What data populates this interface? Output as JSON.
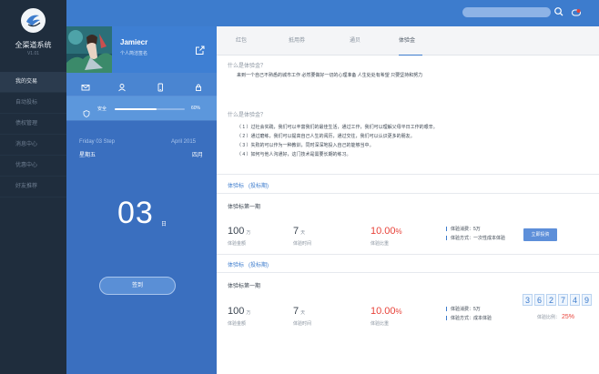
{
  "sidebar": {
    "brand": "全渠道系统",
    "version": "V1.01",
    "items": [
      {
        "label": "我的交易",
        "active": true
      },
      {
        "label": "自动投标",
        "active": false
      },
      {
        "label": "债权管理",
        "active": false
      },
      {
        "label": "消息中心",
        "active": false
      },
      {
        "label": "优惠中心",
        "active": false
      },
      {
        "label": "好友推荐",
        "active": false
      }
    ]
  },
  "profile": {
    "name": "Jamiecr",
    "subtitle": "个人简洁签名"
  },
  "security": {
    "label": "安全",
    "percent": "60%",
    "level": 0.6
  },
  "date": {
    "left": "Friday  03  Step",
    "right": "April  2015",
    "weekday": "星期五",
    "month": "四月",
    "day": "03",
    "day_unit": "日",
    "checkin": "签到"
  },
  "tabs": [
    {
      "label": "红包",
      "active": false
    },
    {
      "label": "抵用券",
      "active": false
    },
    {
      "label": "通贝",
      "active": false
    },
    {
      "label": "体验金",
      "active": true
    }
  ],
  "faq": {
    "q1": "什么是体验金？",
    "a1": "来到一个自己不熟悉的城市工作 必然要做好一切的心理准备  人生处处有希望 只要坚持和努力",
    "q2": "什么是体验金？",
    "points": [
      "（ 1 ）过社会实践，我们可以丰富我们的最佳生活，通过工作，我们可以理解父母平日工作的艰辛。",
      "（ 2 ）通过磨练，我们可以提高自己人生的阅历，通过交往，我们可以认识更多的朋友。",
      "（ 3 ）失败的可以作为一种教训，同时深深地投入自己的能够当中。",
      "（ 4 ）如何与他人沟通好，这门技术是需要长期的练习。"
    ]
  },
  "plans": [
    {
      "head": "体验标",
      "head_link": "(投标期)",
      "name": "体验标第一期",
      "amount": "100",
      "amount_unit": "万",
      "amount_cap": "体验金额",
      "days": "7",
      "days_unit": "天",
      "days_cap": "体验时间",
      "rate": "10.00",
      "rate_unit": "%",
      "rate_cap": "体验比重",
      "info1": "体验消费：5万",
      "info2": "体验方式：一次性成本体验",
      "button": "立即投资"
    },
    {
      "head": "体验标",
      "head_link": "(投标期)",
      "name": "体验标第一期",
      "amount": "100",
      "amount_unit": "万",
      "amount_cap": "体验金额",
      "days": "7",
      "days_unit": "天",
      "days_cap": "体验时间",
      "rate": "10.00",
      "rate_unit": "%",
      "rate_cap": "体验比重",
      "info1": "体验消费：5万",
      "info2": "体验方式：成本体验",
      "digits": [
        "3",
        "6",
        "2",
        "7",
        "4",
        "9"
      ],
      "ratio_label": "体验比例：",
      "ratio_value": "25%"
    }
  ],
  "colors": {
    "topbar": "#3d7ccd",
    "sidebar": "#1f2d3d",
    "accent_red": "#e8433a"
  }
}
